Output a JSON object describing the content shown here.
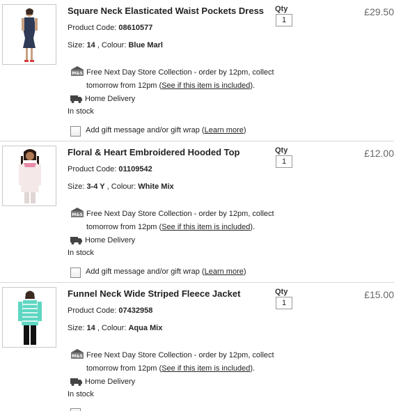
{
  "items": [
    {
      "title": "Square Neck Elasticated Waist Pockets Dress",
      "code_label": "Product Code: ",
      "code": "08610577",
      "size_label": "Size: ",
      "size": "14",
      "colour_label": " , Colour: ",
      "colour": "Blue Marl",
      "qty_label": "Qty",
      "qty": "1",
      "price": "£29.50",
      "store_text_1": "Free Next Day Store Collection - order by 12pm, collect tomorrow  from 12pm (",
      "store_link": "See if this item is included",
      "store_text_2": ").",
      "delivery": "Home Delivery",
      "stock": "In stock",
      "gift_label": "Add gift message and/or gift wrap (",
      "gift_link": "Learn more",
      "gift_end": ")"
    },
    {
      "title": "Floral & Heart Embroidered Hooded Top",
      "code_label": "Product Code: ",
      "code": "01109542",
      "size_label": "Size: ",
      "size": "3-4 Y",
      "colour_label": " , Colour: ",
      "colour": "White Mix",
      "qty_label": "Qty",
      "qty": "1",
      "price": "£12.00",
      "store_text_1": "Free Next Day Store Collection - order by 12pm, collect tomorrow from 12pm (",
      "store_link": "See if this item is included",
      "store_text_2": ").",
      "delivery": "Home Delivery",
      "stock": "In stock",
      "gift_label": "Add gift message and/or gift wrap (",
      "gift_link": "Learn more",
      "gift_end": ")"
    },
    {
      "title": "Funnel Neck Wide Striped Fleece Jacket",
      "code_label": "Product Code: ",
      "code": "07432958",
      "size_label": "Size: ",
      "size": "14",
      "colour_label": " , Colour: ",
      "colour": "Aqua Mix",
      "qty_label": "Qty",
      "qty": "1",
      "price": "£15.00",
      "store_text_1": "Free Next Day Store Collection - order by 12pm, collect tomorrow from 12pm (",
      "store_link": "See if this item is included",
      "store_text_2": ").",
      "delivery": "Home Delivery",
      "stock": "In stock"
    }
  ],
  "icons": {
    "store": "m-and-s-store-icon",
    "delivery": "delivery-truck-icon"
  },
  "colors": {
    "text": "#222222",
    "price": "#666666",
    "separator": "#d8d8d8"
  }
}
